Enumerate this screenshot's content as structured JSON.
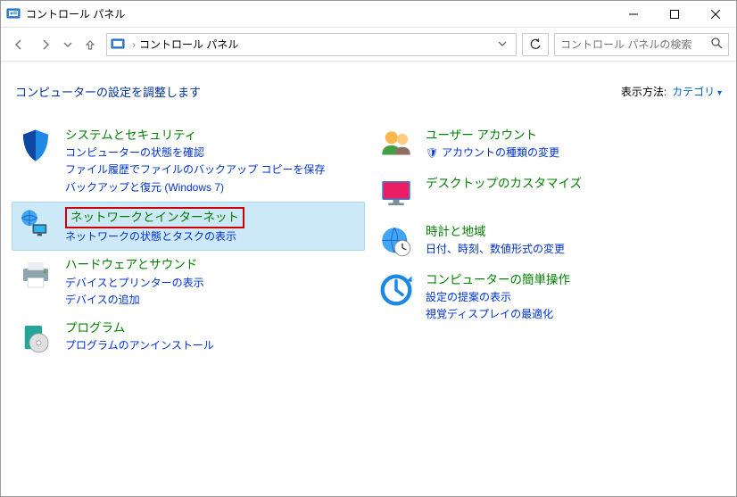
{
  "window": {
    "title": "コントロール パネル"
  },
  "breadcrumb": {
    "crumb1": "コントロール パネル"
  },
  "search": {
    "placeholder": "コントロール パネルの検索"
  },
  "heading": "コンピューターの設定を調整します",
  "view": {
    "label": "表示方法:",
    "value": "カテゴリ"
  },
  "left": [
    {
      "title": "システムとセキュリティ",
      "links": [
        "コンピューターの状態を確認",
        "ファイル履歴でファイルのバックアップ コピーを保存",
        "バックアップと復元 (Windows 7)"
      ]
    },
    {
      "title": "ネットワークとインターネット",
      "links": [
        "ネットワークの状態とタスクの表示"
      ],
      "highlighted": true
    },
    {
      "title": "ハードウェアとサウンド",
      "links": [
        "デバイスとプリンターの表示",
        "デバイスの追加"
      ]
    },
    {
      "title": "プログラム",
      "links": [
        "プログラムのアンインストール"
      ]
    }
  ],
  "right": [
    {
      "title": "ユーザー アカウント",
      "links": [
        "アカウントの種類の変更"
      ],
      "shield": [
        true
      ]
    },
    {
      "title": "デスクトップのカスタマイズ",
      "links": []
    },
    {
      "title": "時計と地域",
      "links": [
        "日付、時刻、数値形式の変更"
      ]
    },
    {
      "title": "コンピューターの簡単操作",
      "links": [
        "設定の提案の表示",
        "視覚ディスプレイの最適化"
      ]
    }
  ]
}
